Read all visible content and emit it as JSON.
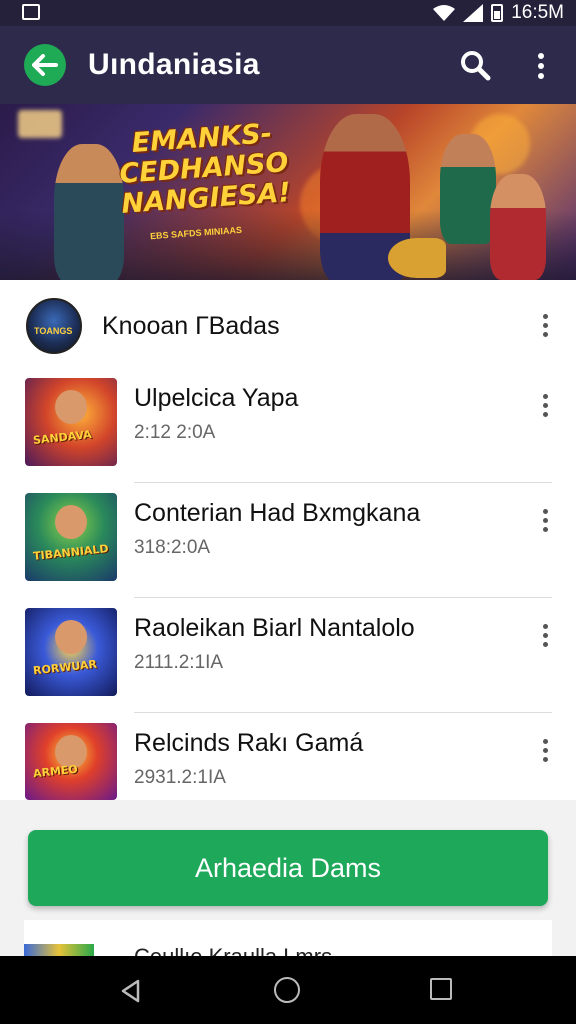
{
  "status_bar": {
    "time": "16:5M"
  },
  "app_bar": {
    "title": "Uındaniasia"
  },
  "banner": {
    "headline": "EMANKS-CEDHANSO NANGIESA!",
    "subline": "EBS SAFDS MINIAAS"
  },
  "section": {
    "title": "Knooan ГBadas",
    "avatar_label": "TOANGS"
  },
  "games": [
    {
      "title": "Ulpelcica Yapa",
      "subtitle": "2:12 2:0A",
      "thumb_label": "SANDAVA"
    },
    {
      "title": "Conterian Had Bxmgkana",
      "subtitle": "318:2:0A",
      "thumb_label": "TIBANNIALD"
    },
    {
      "title": "Raoleikan Biarl Nantalolo",
      "subtitle": "2111.2:1IA",
      "thumb_label": "RORWUAR"
    },
    {
      "title": "Relcinds Rakı Gamá",
      "subtitle": "2931.2:1IA",
      "thumb_label": "ARMEO"
    }
  ],
  "cta": {
    "label": "Arhaedia Dams"
  },
  "peek": {
    "text": "Ceullıe Kraulla Lmrs"
  },
  "icons": {
    "back": "arrow-left-icon",
    "search": "search-icon",
    "more": "more-vert-icon",
    "nav_back": "triangle-back-icon",
    "nav_home": "circle-home-icon",
    "nav_recents": "square-recents-icon"
  },
  "colors": {
    "app_bar": "#2e2a4b",
    "accent_green": "#1ea85a",
    "status_bar": "#25213a"
  }
}
